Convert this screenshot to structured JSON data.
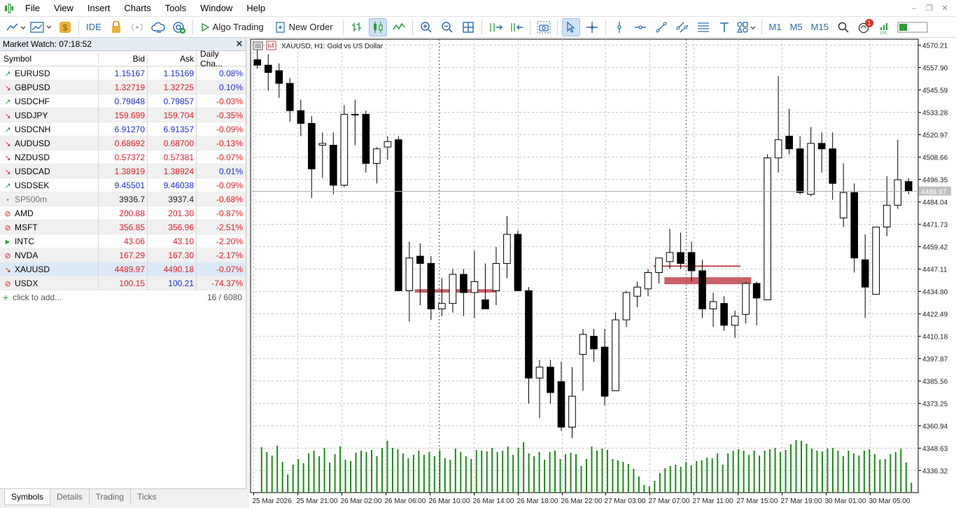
{
  "menu": [
    "File",
    "View",
    "Insert",
    "Charts",
    "Tools",
    "Window",
    "Help"
  ],
  "toolbar": {
    "ide": "IDE",
    "algo_trading": "Algo Trading",
    "new_order": "New Order",
    "timeframes": [
      "M1",
      "M5",
      "M15"
    ],
    "notification_count": "1"
  },
  "market_watch": {
    "title": "Market Watch: 07:18:52",
    "headers": {
      "symbol": "Symbol",
      "bid": "Bid",
      "ask": "Ask",
      "change": "Daily Cha..."
    },
    "rows": [
      {
        "symbol": "EURUSD",
        "bid": "1.15167",
        "ask": "1.15169",
        "change": "0.08%",
        "dir": "up",
        "icon": "arrow-up-icon"
      },
      {
        "symbol": "GBPUSD",
        "bid": "1.32719",
        "ask": "1.32725",
        "change": "0.10%",
        "dir": "down",
        "icon": "arrow-down-icon"
      },
      {
        "symbol": "USDCHF",
        "bid": "0.79848",
        "ask": "0.79857",
        "change": "-0.03%",
        "dir": "up",
        "icon": "arrow-up-icon"
      },
      {
        "symbol": "USDJPY",
        "bid": "159.699",
        "ask": "159.704",
        "change": "-0.35%",
        "dir": "down",
        "icon": "arrow-down-icon"
      },
      {
        "symbol": "USDCNH",
        "bid": "6.91270",
        "ask": "6.91357",
        "change": "-0.09%",
        "dir": "up",
        "icon": "arrow-up-icon"
      },
      {
        "symbol": "AUDUSD",
        "bid": "0.68692",
        "ask": "0.68700",
        "change": "-0.13%",
        "dir": "down",
        "icon": "arrow-down-icon"
      },
      {
        "symbol": "NZDUSD",
        "bid": "0.57372",
        "ask": "0.57381",
        "change": "-0.07%",
        "dir": "down",
        "icon": "arrow-down-icon"
      },
      {
        "symbol": "USDCAD",
        "bid": "1.38919",
        "ask": "1.38924",
        "change": "0.01%",
        "dir": "down",
        "icon": "arrow-down-icon"
      },
      {
        "symbol": "USDSEK",
        "bid": "9.45501",
        "ask": "9.46038",
        "change": "-0.09%",
        "dir": "up",
        "icon": "arrow-up-icon"
      },
      {
        "symbol": "SP500m",
        "bid": "3936.7",
        "ask": "3937.4",
        "change": "-0.68%",
        "dir": "neutral",
        "icon": "dot-icon"
      },
      {
        "symbol": "AMD",
        "bid": "200.88",
        "ask": "201.30",
        "change": "-0.87%",
        "dir": "down",
        "icon": "stop-icon"
      },
      {
        "symbol": "MSFT",
        "bid": "356.85",
        "ask": "356.96",
        "change": "-2.51%",
        "dir": "down",
        "icon": "stop-icon"
      },
      {
        "symbol": "INTC",
        "bid": "43.06",
        "ask": "43.10",
        "change": "-2.20%",
        "dir": "down",
        "icon": "play-icon"
      },
      {
        "symbol": "NVDA",
        "bid": "167.29",
        "ask": "167.30",
        "change": "-2.17%",
        "dir": "down",
        "icon": "stop-icon"
      },
      {
        "symbol": "XAUUSD",
        "bid": "4489.97",
        "ask": "4490.18",
        "change": "-0.07%",
        "dir": "down",
        "icon": "arrow-down-icon"
      },
      {
        "symbol": "USDX",
        "bid": "100.15",
        "ask": "100.21",
        "change": "-74.37%",
        "dir": "mixed",
        "icon": "stop-icon"
      }
    ],
    "add_label": "click to add...",
    "count": "16 / 6080"
  },
  "bottom_tabs": [
    "Symbols",
    "Details",
    "Trading",
    "Ticks"
  ],
  "chart_header": {
    "title": "XAUUSD, H1:  Gold vs US Dollar"
  },
  "chart_data": {
    "type": "candlestick",
    "symbol": "XAUUSD",
    "timeframe": "H1",
    "ylim": [
      4336.32,
      4570.21
    ],
    "price_ticks": [
      "4570.21",
      "4557.90",
      "4545.59",
      "4533.28",
      "4520.97",
      "4508.66",
      "4496.35",
      "4484.04",
      "4471.73",
      "4459.42",
      "4447.11",
      "4434.80",
      "4422.49",
      "4410.18",
      "4397.87",
      "4385.56",
      "4373.25",
      "4360.94",
      "4348.63",
      "4336.32"
    ],
    "current_price": "4489.97",
    "time_labels": [
      "25 Mar 2026",
      "25 Mar 21:00",
      "26 Mar 02:00",
      "26 Mar 06:00",
      "26 Mar 10:00",
      "26 Mar 14:00",
      "26 Mar 18:00",
      "26 Mar 22:00",
      "27 Mar 03:00",
      "27 Mar 07:00",
      "27 Mar 11:00",
      "27 Mar 15:00",
      "27 Mar 19:00",
      "30 Mar 01:00",
      "30 Mar 05:00"
    ],
    "candles": [
      {
        "o": 4562,
        "h": 4570,
        "l": 4557,
        "c": 4559
      },
      {
        "o": 4559,
        "h": 4565,
        "l": 4545,
        "c": 4555
      },
      {
        "o": 4556,
        "h": 4560,
        "l": 4541,
        "c": 4549
      },
      {
        "o": 4549,
        "h": 4552,
        "l": 4528,
        "c": 4534
      },
      {
        "o": 4534,
        "h": 4540,
        "l": 4520,
        "c": 4527
      },
      {
        "o": 4527,
        "h": 4531,
        "l": 4486,
        "c": 4502
      },
      {
        "o": 4515,
        "h": 4522,
        "l": 4497,
        "c": 4516
      },
      {
        "o": 4515,
        "h": 4522,
        "l": 4488,
        "c": 4493
      },
      {
        "o": 4493,
        "h": 4537,
        "l": 4492,
        "c": 4532
      },
      {
        "o": 4532,
        "h": 4540,
        "l": 4515,
        "c": 4532
      },
      {
        "o": 4532,
        "h": 4534,
        "l": 4500,
        "c": 4505
      },
      {
        "o": 4505,
        "h": 4514,
        "l": 4494,
        "c": 4513
      },
      {
        "o": 4514,
        "h": 4520,
        "l": 4507,
        "c": 4517
      },
      {
        "o": 4518,
        "h": 4520,
        "l": 4435,
        "c": 4435
      },
      {
        "o": 4435,
        "h": 4462,
        "l": 4418,
        "c": 4453
      },
      {
        "o": 4454,
        "h": 4461,
        "l": 4427,
        "c": 4450
      },
      {
        "o": 4450,
        "h": 4454,
        "l": 4419,
        "c": 4425
      },
      {
        "o": 4425,
        "h": 4442,
        "l": 4421,
        "c": 4428
      },
      {
        "o": 4428,
        "h": 4447,
        "l": 4423,
        "c": 4444
      },
      {
        "o": 4444,
        "h": 4447,
        "l": 4421,
        "c": 4434
      },
      {
        "o": 4434,
        "h": 4457,
        "l": 4420,
        "c": 4440
      },
      {
        "o": 4430,
        "h": 4450,
        "l": 4425,
        "c": 4425
      },
      {
        "o": 4435,
        "h": 4459,
        "l": 4427,
        "c": 4450
      },
      {
        "o": 4450,
        "h": 4476,
        "l": 4442,
        "c": 4466
      },
      {
        "o": 4466,
        "h": 4468,
        "l": 4438,
        "c": 4435
      },
      {
        "o": 4435,
        "h": 4437,
        "l": 4373,
        "c": 4387
      },
      {
        "o": 4387,
        "h": 4397,
        "l": 4365,
        "c": 4393
      },
      {
        "o": 4393,
        "h": 4397,
        "l": 4373,
        "c": 4379
      },
      {
        "o": 4385,
        "h": 4396,
        "l": 4358,
        "c": 4360
      },
      {
        "o": 4360,
        "h": 4393,
        "l": 4354,
        "c": 4377
      },
      {
        "o": 4400,
        "h": 4414,
        "l": 4380,
        "c": 4411
      },
      {
        "o": 4410,
        "h": 4414,
        "l": 4396,
        "c": 4403
      },
      {
        "o": 4404,
        "h": 4414,
        "l": 4372,
        "c": 4377
      },
      {
        "o": 4380,
        "h": 4423,
        "l": 4380,
        "c": 4419
      },
      {
        "o": 4419,
        "h": 4435,
        "l": 4415,
        "c": 4434
      },
      {
        "o": 4432,
        "h": 4440,
        "l": 4426,
        "c": 4437
      },
      {
        "o": 4436,
        "h": 4447,
        "l": 4432,
        "c": 4445
      },
      {
        "o": 4445,
        "h": 4453,
        "l": 4439,
        "c": 4453
      },
      {
        "o": 4451,
        "h": 4469,
        "l": 4447,
        "c": 4456
      },
      {
        "o": 4456,
        "h": 4467,
        "l": 4447,
        "c": 4450
      },
      {
        "o": 4456,
        "h": 4462,
        "l": 4440,
        "c": 4446
      },
      {
        "o": 4446,
        "h": 4452,
        "l": 4420,
        "c": 4425
      },
      {
        "o": 4425,
        "h": 4434,
        "l": 4415,
        "c": 4429
      },
      {
        "o": 4428,
        "h": 4432,
        "l": 4413,
        "c": 4416
      },
      {
        "o": 4416,
        "h": 4424,
        "l": 4409,
        "c": 4421
      },
      {
        "o": 4422,
        "h": 4440,
        "l": 4417,
        "c": 4439
      },
      {
        "o": 4439,
        "h": 4440,
        "l": 4416,
        "c": 4431
      },
      {
        "o": 4430,
        "h": 4510,
        "l": 4430,
        "c": 4508
      },
      {
        "o": 4508,
        "h": 4553,
        "l": 4500,
        "c": 4518
      },
      {
        "o": 4520,
        "h": 4535,
        "l": 4510,
        "c": 4513
      },
      {
        "o": 4513,
        "h": 4520,
        "l": 4488,
        "c": 4489
      },
      {
        "o": 4488,
        "h": 4525,
        "l": 4487,
        "c": 4516
      },
      {
        "o": 4516,
        "h": 4522,
        "l": 4500,
        "c": 4513
      },
      {
        "o": 4513,
        "h": 4522,
        "l": 4485,
        "c": 4494
      },
      {
        "o": 4475,
        "h": 4505,
        "l": 4470,
        "c": 4489
      },
      {
        "o": 4489,
        "h": 4494,
        "l": 4445,
        "c": 4453
      },
      {
        "o": 4452,
        "h": 4466,
        "l": 4420,
        "c": 4437
      },
      {
        "o": 4433,
        "h": 4470,
        "l": 4433,
        "c": 4470
      },
      {
        "o": 4470,
        "h": 4498,
        "l": 4465,
        "c": 4482
      },
      {
        "o": 4482,
        "h": 4518,
        "l": 4480,
        "c": 4496
      },
      {
        "o": 4495,
        "h": 4497,
        "l": 4488,
        "c": 4490
      }
    ],
    "volumes": [
      65,
      58,
      53,
      67,
      44,
      26,
      40,
      48,
      42,
      56,
      60,
      52,
      64,
      43,
      55,
      66,
      47,
      45,
      57,
      60,
      58,
      61,
      52,
      64,
      74,
      64,
      62,
      56,
      49,
      54,
      60,
      54,
      58,
      52,
      60,
      49,
      47,
      63,
      58,
      52,
      48,
      61,
      60,
      59,
      64,
      58,
      60,
      66,
      54,
      64,
      72,
      56,
      52,
      58,
      47,
      58,
      60,
      48,
      55,
      57,
      55,
      38,
      48,
      66,
      60,
      63,
      61,
      48,
      46,
      44,
      41,
      34,
      23,
      11,
      9,
      17,
      28,
      35,
      38,
      40,
      37,
      44,
      39,
      45,
      46,
      50,
      49,
      56,
      40,
      56,
      60,
      62,
      60,
      54,
      60,
      53,
      60,
      62,
      64,
      58,
      61,
      69,
      75,
      74,
      70,
      63,
      60,
      59,
      63,
      64,
      60,
      52,
      60,
      56,
      53,
      60,
      62,
      55,
      47,
      48,
      55,
      58,
      63,
      43,
      14
    ],
    "levels": [
      {
        "price": 4448.5,
        "from_candle": 37,
        "to_candle": 44,
        "label": ""
      },
      {
        "price": 4440.5,
        "from_candle": 38,
        "to_candle": 45,
        "label": ""
      }
    ]
  }
}
